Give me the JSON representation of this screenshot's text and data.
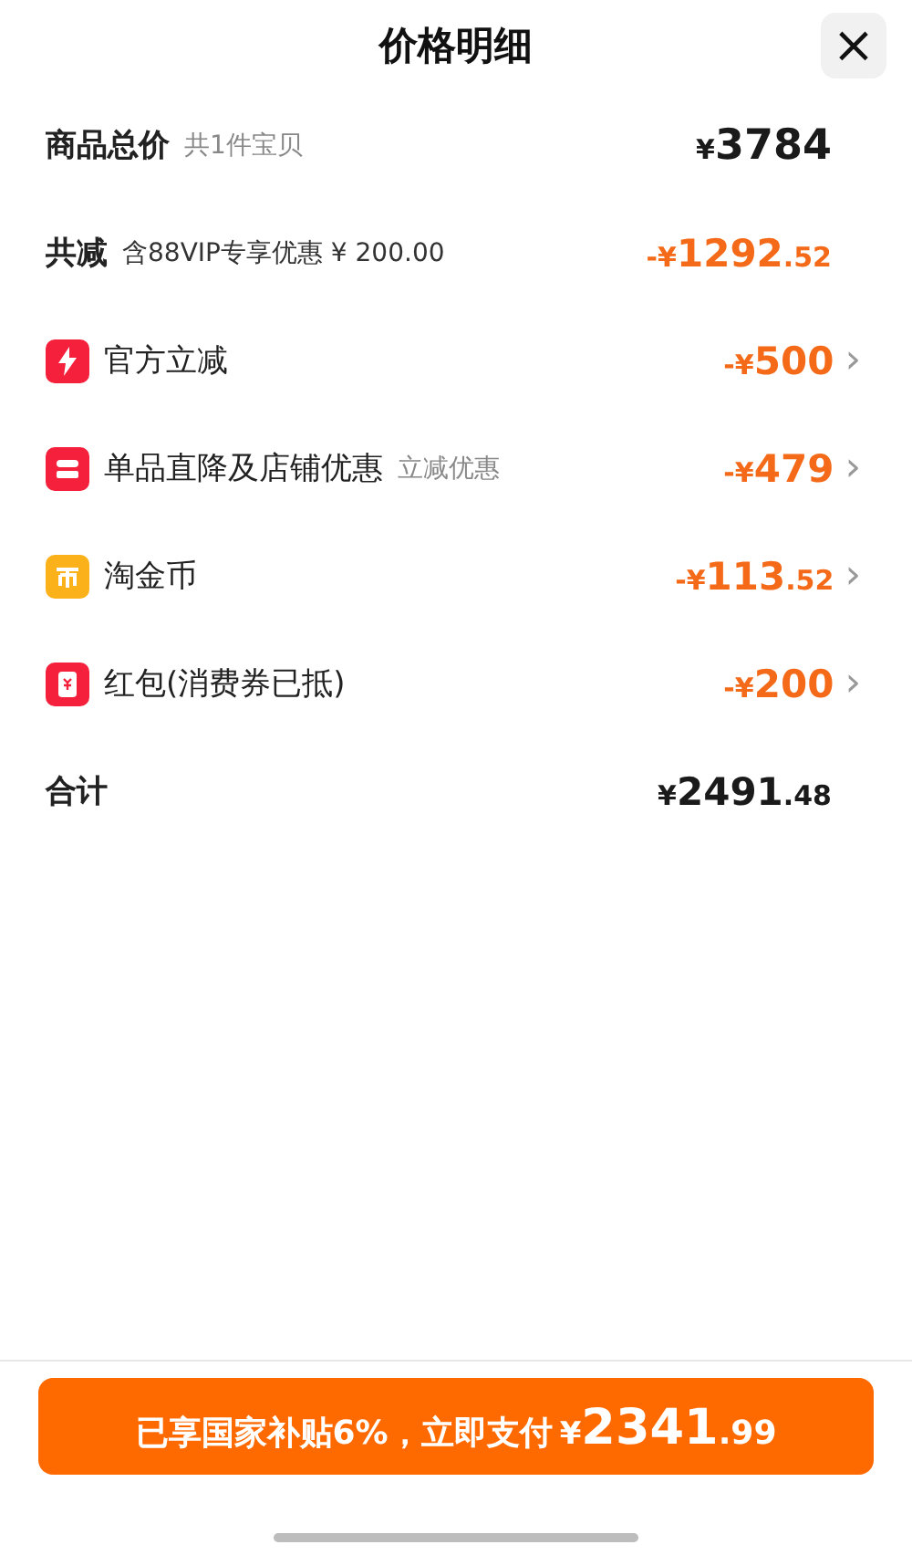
{
  "header": {
    "title": "价格明细",
    "close": "×"
  },
  "summary": [
    {
      "kind": "total",
      "label": "商品总价",
      "note": "共1件宝贝",
      "amount": {
        "sign": "¥",
        "whole": "3784"
      }
    },
    {
      "kind": "discount",
      "label": "共减",
      "note": "含88VIP专享优惠 ¥ 200.00",
      "amount": {
        "sign": "-¥",
        "whole": "1292",
        "cents": ".52"
      }
    }
  ],
  "items": [
    {
      "kind": "bolt",
      "color": "#f5203c",
      "label": "官方立减",
      "amount": {
        "sign": "-¥",
        "whole": "500"
      }
    },
    {
      "kind": "shop",
      "color": "#f5203c",
      "label": "单品直降及店铺优惠",
      "note": "立减优惠",
      "amount": {
        "sign": "-¥",
        "whole": "479"
      }
    },
    {
      "kind": "coin",
      "color": "#fbb11a",
      "label": "淘金币",
      "amount": {
        "sign": "-¥",
        "whole": "113",
        "cents": ".52"
      }
    },
    {
      "kind": "packet",
      "color": "#f5203c",
      "label": "红包(消费券已抵)",
      "amount": {
        "sign": "-¥",
        "whole": "200"
      }
    }
  ],
  "chevron": "›",
  "total": {
    "label": "合计",
    "amount": {
      "sign": "¥",
      "whole": "2491",
      "cents": ".48"
    }
  },
  "pay_button": {
    "text": "已享国家补贴6%，立即支付",
    "amount": {
      "sign": "¥",
      "whole": "2341",
      "cents": ".99"
    }
  }
}
